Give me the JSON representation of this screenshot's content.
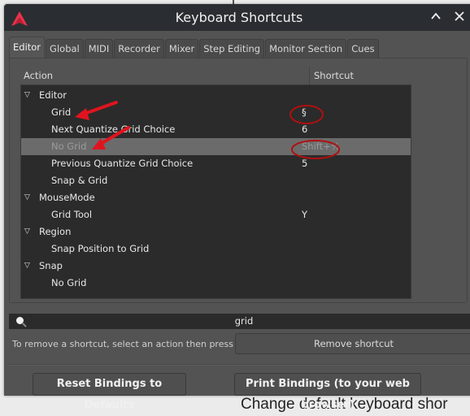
{
  "window": {
    "title": "Keyboard Shortcuts",
    "minimize_icon": "chevron-up-icon",
    "close_icon": "close-icon",
    "logo_color": "#e8324a"
  },
  "tabs": [
    {
      "label": "Editor",
      "active": true
    },
    {
      "label": "Global"
    },
    {
      "label": "MIDI"
    },
    {
      "label": "Recorder"
    },
    {
      "label": "Mixer"
    },
    {
      "label": "Step Editing"
    },
    {
      "label": "Monitor Section"
    },
    {
      "label": "Cues"
    }
  ],
  "table": {
    "columns": {
      "action": "Action",
      "shortcut": "Shortcut"
    },
    "rows": [
      {
        "type": "group",
        "label": "Editor",
        "shortcut": ""
      },
      {
        "type": "child",
        "label": "Grid",
        "shortcut": "§"
      },
      {
        "type": "child",
        "label": "Next Quantize Grid Choice",
        "shortcut": "6"
      },
      {
        "type": "child",
        "label": "No Grid",
        "shortcut": "Shift+½",
        "selected": true
      },
      {
        "type": "child",
        "label": "Previous Quantize Grid Choice",
        "shortcut": "5"
      },
      {
        "type": "child",
        "label": "Snap & Grid",
        "shortcut": ""
      },
      {
        "type": "group",
        "label": "MouseMode",
        "shortcut": ""
      },
      {
        "type": "child",
        "label": "Grid Tool",
        "shortcut": "Y"
      },
      {
        "type": "group",
        "label": "Region",
        "shortcut": ""
      },
      {
        "type": "child",
        "label": "Snap Position to Grid",
        "shortcut": ""
      },
      {
        "type": "group",
        "label": "Snap",
        "shortcut": ""
      },
      {
        "type": "child",
        "label": "No Grid",
        "shortcut": ""
      }
    ]
  },
  "search": {
    "value": "grid",
    "icon": "search-icon"
  },
  "remove": {
    "hint": "To remove a shortcut, select an action then press this:",
    "button": "Remove shortcut"
  },
  "buttons": {
    "reset": "Reset Bindings to Defaults",
    "print": "Print Bindings (to your web browser)"
  },
  "background_text": "Change default keyboard shor",
  "annotation_color": "#e0141e"
}
